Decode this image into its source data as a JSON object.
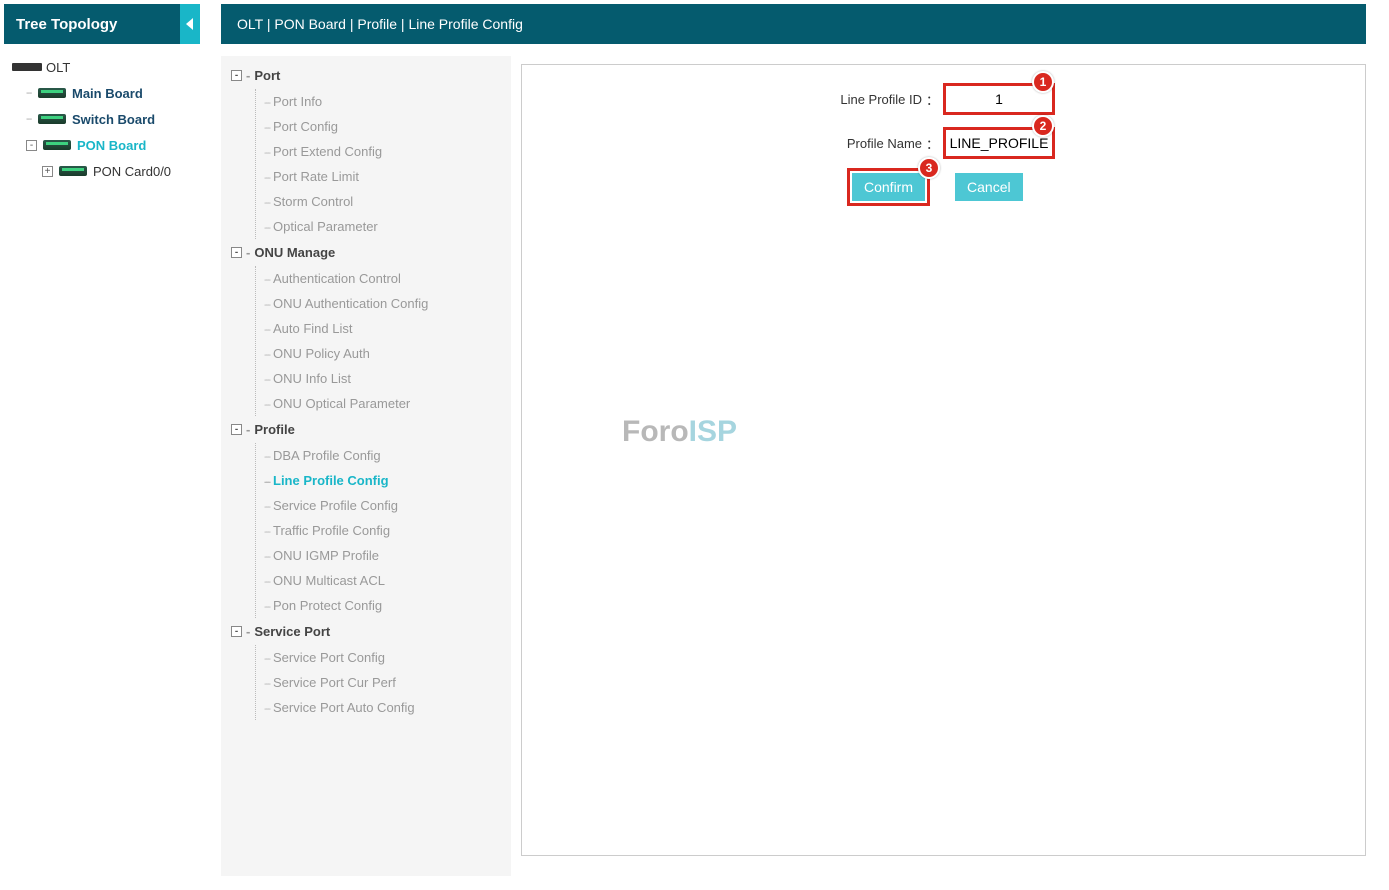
{
  "tree": {
    "header": "Tree Topology",
    "root": "OLT",
    "main_board": "Main Board",
    "switch_board": "Switch Board",
    "pon_board": "PON Board",
    "pon_card": "PON Card0/0"
  },
  "breadcrumb": "OLT | PON Board | Profile | Line Profile Config",
  "sections": {
    "port": {
      "title": "Port",
      "items": [
        "Port Info",
        "Port Config",
        "Port Extend Config",
        "Port Rate Limit",
        "Storm Control",
        "Optical Parameter"
      ]
    },
    "onu": {
      "title": "ONU Manage",
      "items": [
        "Authentication Control",
        "ONU Authentication Config",
        "Auto Find List",
        "ONU Policy Auth",
        "ONU Info List",
        "ONU Optical Parameter"
      ]
    },
    "profile": {
      "title": "Profile",
      "items": [
        "DBA Profile Config",
        "Line Profile Config",
        "Service Profile Config",
        "Traffic Profile Config",
        "ONU IGMP Profile",
        "ONU Multicast ACL",
        "Pon Protect Config"
      ]
    },
    "service": {
      "title": "Service Port",
      "items": [
        "Service Port Config",
        "Service Port Cur Perf",
        "Service Port Auto Config"
      ]
    }
  },
  "form": {
    "id_label": "Line Profile ID",
    "id_value": "1",
    "name_label": "Profile Name",
    "name_value": "LINE_PROFILE",
    "confirm": "Confirm",
    "cancel": "Cancel"
  },
  "badges": {
    "b1": "1",
    "b2": "2",
    "b3": "3"
  },
  "watermark": {
    "foro": "Foro",
    "isp": "SP"
  }
}
